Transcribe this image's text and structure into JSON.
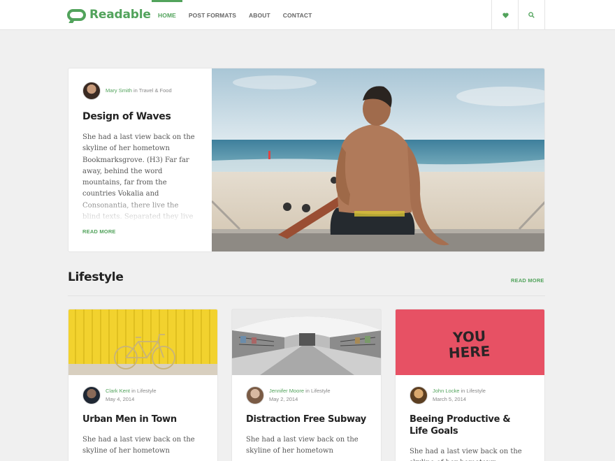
{
  "header": {
    "logo_text": "Readable",
    "nav": [
      "HOME",
      "POST FORMATS",
      "ABOUT",
      "CONTACT"
    ],
    "active_nav": "HOME",
    "accent_color": "#52a35c"
  },
  "featured": {
    "author": "Mary Smith",
    "in_word": " in ",
    "category": "Travel & Food",
    "title": "Design of Waves",
    "excerpt": "She had a last view back on the skyline of her hometown Bookmarksgrove. (H3) Far far away, behind the word mountains, far from the countries Vokalia and Consonantia, there live the blind texts. Separated they live in Bookmarksgrove right",
    "read_more": "READ MORE"
  },
  "section": {
    "title": "Lifestyle",
    "read_more": "READ MORE"
  },
  "cards": [
    {
      "author": "Clark Kent",
      "in_word": " in ",
      "category": "Lifestyle",
      "date": "May 4, 2014",
      "title": "Urban Men in Town",
      "excerpt": "She had a last view back on the skyline of her hometown"
    },
    {
      "author": "Jennifer Moore",
      "in_word": " in ",
      "category": "Lifestyle",
      "date": "May 2, 2014",
      "title": "Distraction Free Subway",
      "excerpt": "She had a last view back on the skyline of her hometown"
    },
    {
      "author": "John Locke",
      "in_word": " in ",
      "category": "Lifestyle",
      "date": "March 5, 2014",
      "title": "Beeing Productive & Life Goals",
      "excerpt": "She had a last view back on the skyline of her hometown",
      "image_text": [
        "YOU",
        "HERE"
      ]
    }
  ]
}
